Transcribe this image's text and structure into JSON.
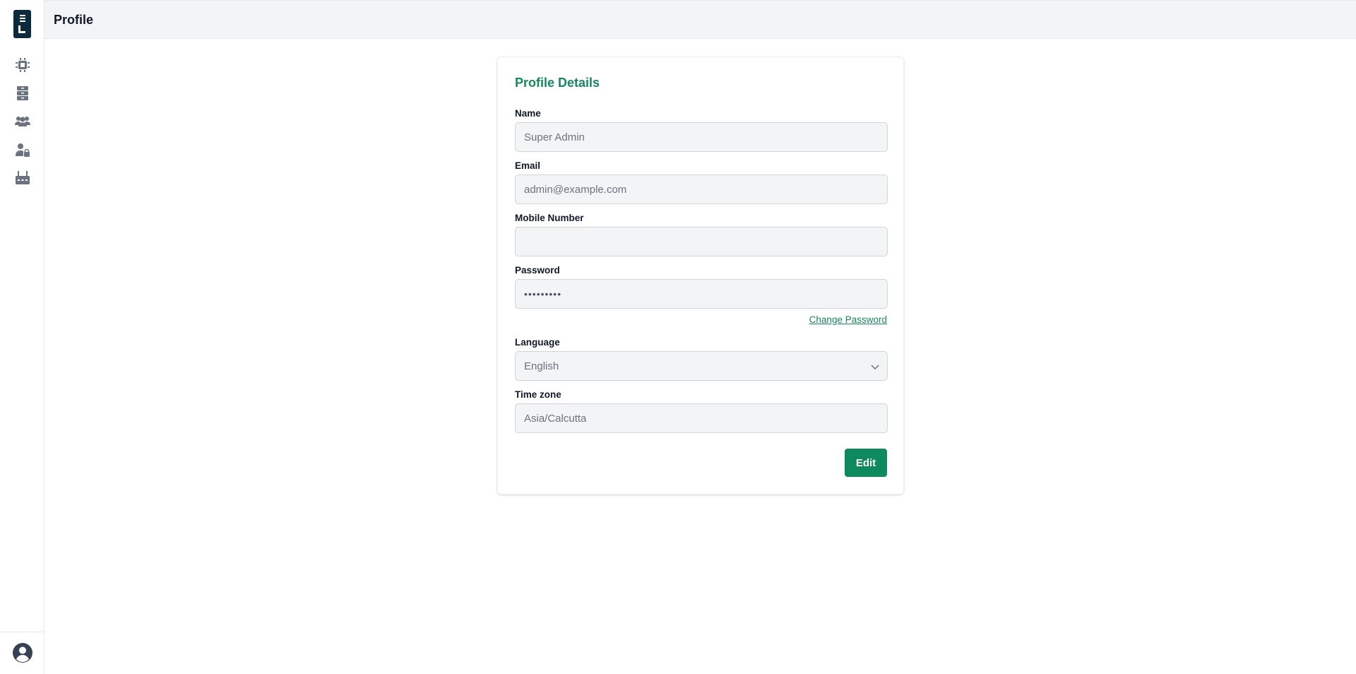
{
  "header": {
    "title": "Profile"
  },
  "sidebar": {
    "logo_icon": "logo-icon",
    "items": [
      {
        "icon": "chip-icon"
      },
      {
        "icon": "server-icon"
      },
      {
        "icon": "users-icon"
      },
      {
        "icon": "user-lock-icon"
      },
      {
        "icon": "router-icon"
      }
    ],
    "bottom_icon": "user-circle-icon"
  },
  "card": {
    "title": "Profile Details",
    "fields": {
      "name": {
        "label": "Name",
        "value": "Super Admin"
      },
      "email": {
        "label": "Email",
        "value": "admin@example.com"
      },
      "mobile": {
        "label": "Mobile Number",
        "value": ""
      },
      "password": {
        "label": "Password",
        "value": "•••••••••"
      },
      "language": {
        "label": "Language",
        "value": "English"
      },
      "timezone": {
        "label": "Time zone",
        "value": "Asia/Calcutta"
      }
    },
    "change_password_label": "Change Password",
    "edit_label": "Edit"
  },
  "colors": {
    "accent": "#15885d",
    "button": "#0f8a5f",
    "logo_bg": "#0b2a3d",
    "icon_gray": "#6b7280"
  }
}
